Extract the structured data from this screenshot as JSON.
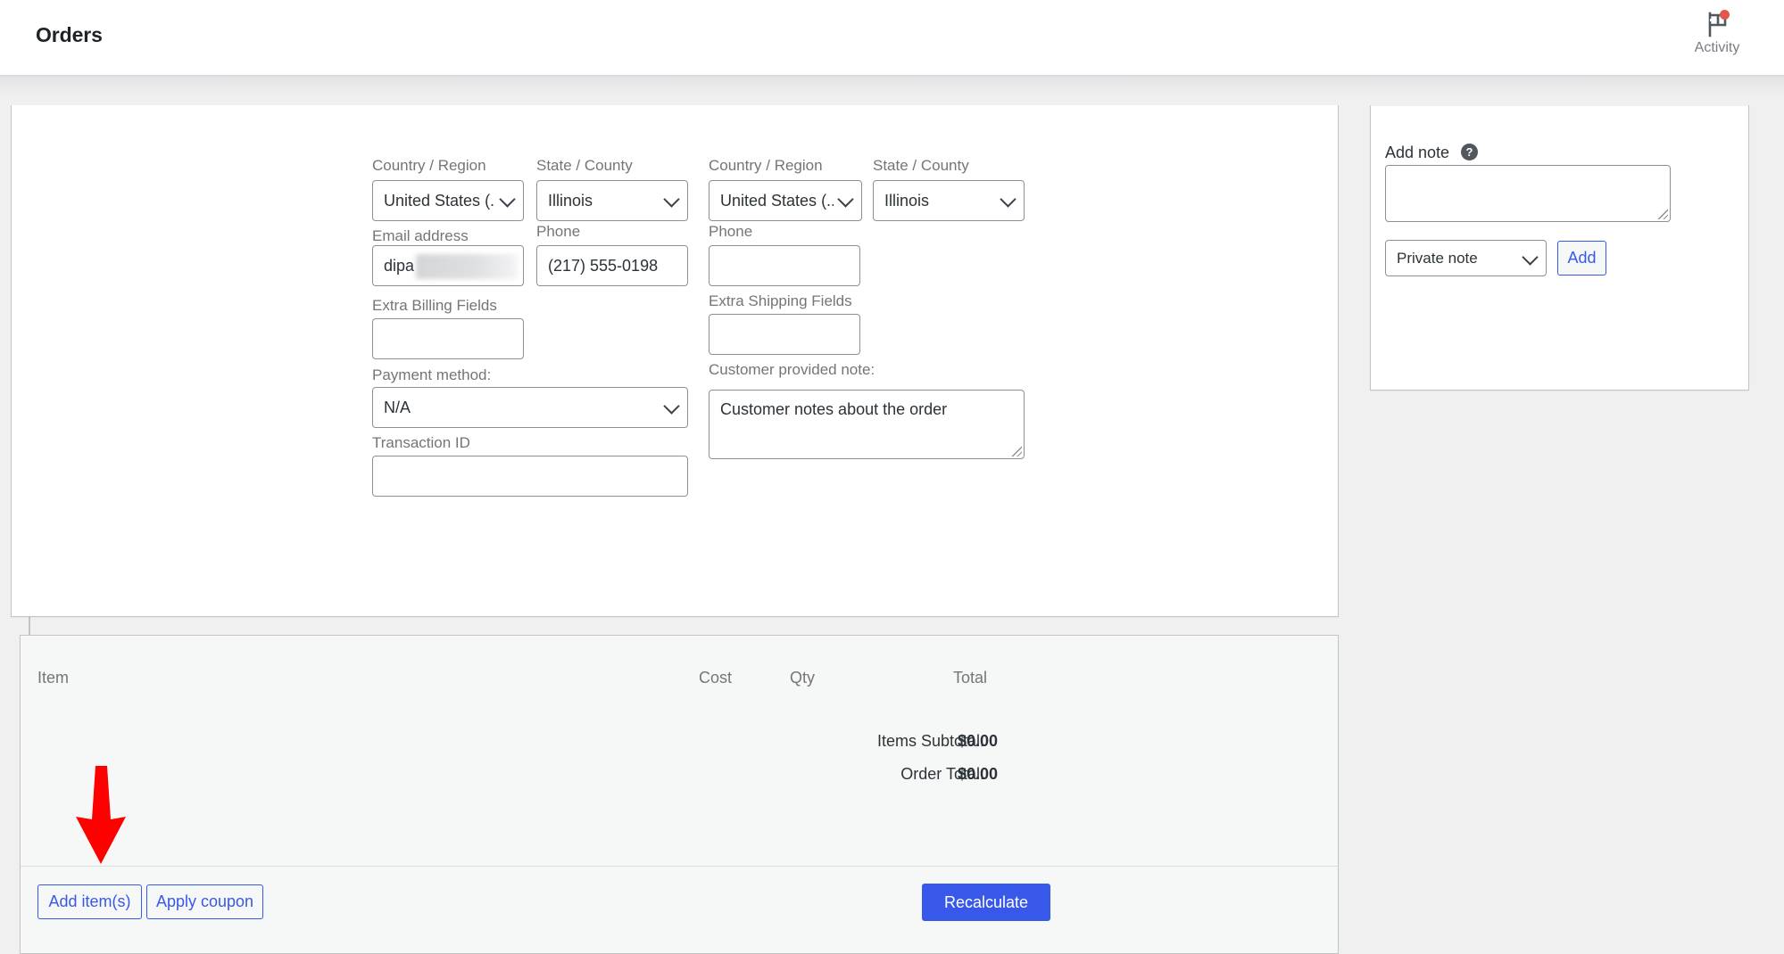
{
  "header": {
    "title": "Orders",
    "activity_label": "Activity",
    "activity_icon": "flag-icon",
    "has_notification": true,
    "notification_color": "#e2574c"
  },
  "order_data": {
    "billing": {
      "country_label": "Country / Region",
      "country_value": "United States (...",
      "state_label": "State / County",
      "state_value": "Illinois",
      "email_label": "Email address",
      "email_value": "dipa",
      "email_redacted": true,
      "phone_label": "Phone",
      "phone_value": "(217) 555-0198",
      "extra_fields_label": "Extra Billing Fields",
      "extra_fields_value": "",
      "payment_method_label": "Payment method:",
      "payment_method_value": "N/A",
      "transaction_id_label": "Transaction ID",
      "transaction_id_value": ""
    },
    "shipping": {
      "country_label": "Country / Region",
      "country_value": "United States (...",
      "state_label": "State / County",
      "state_value": "Illinois",
      "phone_label": "Phone",
      "phone_value": "",
      "extra_fields_label": "Extra Shipping Fields",
      "extra_fields_value": "",
      "customer_note_label": "Customer provided note:",
      "customer_note_value": "Customer notes about the order"
    }
  },
  "order_items": {
    "columns": {
      "item": "Item",
      "cost": "Cost",
      "qty": "Qty",
      "total": "Total"
    },
    "rows": [],
    "totals": [
      {
        "label": "Items Subtotal:",
        "value": "$0.00"
      },
      {
        "label": "Order Total:",
        "value": "$0.00"
      }
    ],
    "actions": {
      "add_items": "Add item(s)",
      "apply_coupon": "Apply coupon",
      "recalculate": "Recalculate"
    }
  },
  "order_notes": {
    "add_note_label": "Add note",
    "help_icon": "help-icon",
    "help_glyph": "?",
    "note_value": "",
    "note_type_value": "Private note",
    "add_button": "Add"
  },
  "colors": {
    "accent": "#3858e9",
    "notification": "#e2574c",
    "annotation_arrow": "#ff0000",
    "page_bg": "#f0f0f1",
    "card_bg": "#ffffff",
    "panel_bg": "#f6f7f7",
    "label_text": "#757575",
    "body_text": "#2c3338"
  },
  "annotation": {
    "arrow_icon": "down-arrow-annotation",
    "points_at": "Add item(s)"
  }
}
